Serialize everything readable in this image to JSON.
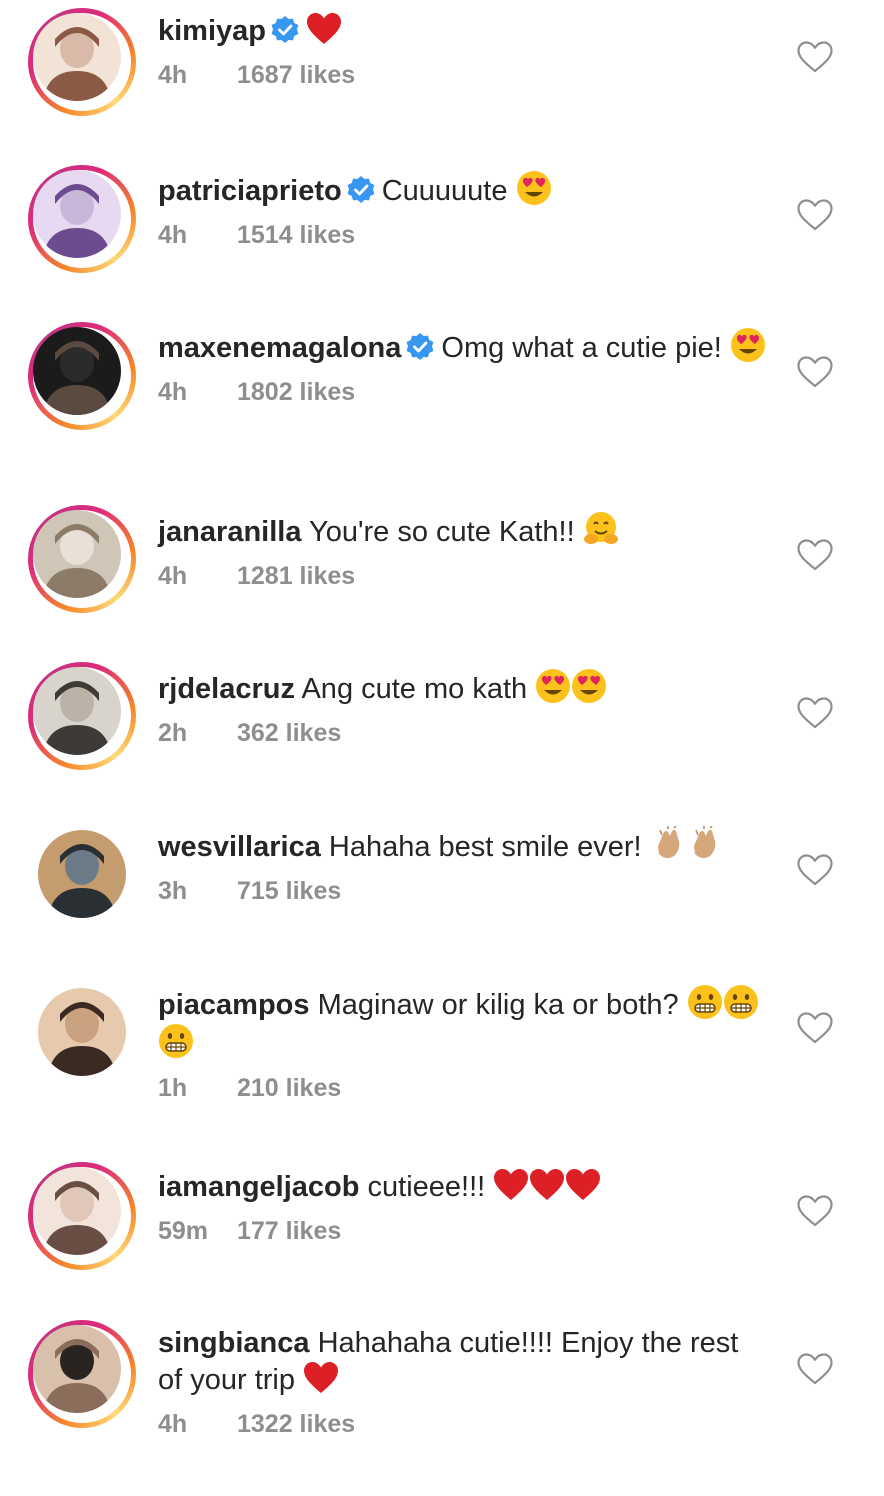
{
  "colors": {
    "text": "#262626",
    "meta": "#8e8e8e",
    "verified": "#3897f0",
    "heart": "#ed4956"
  },
  "icons": {
    "like": "heart-outline-icon",
    "verified": "verified-badge-icon",
    "avatar": "avatar-photo"
  },
  "comments": [
    {
      "username": "kimiyap",
      "verified": true,
      "text": "",
      "emojis_after": [
        "red-heart"
      ],
      "time": "4h",
      "likes": "1687 likes",
      "ring": true
    },
    {
      "username": "patriciaprieto",
      "verified": true,
      "text": "Cuuuuute",
      "emojis_after": [
        "heart-eyes"
      ],
      "time": "4h",
      "likes": "1514 likes",
      "ring": true
    },
    {
      "username": "maxenemagalona",
      "verified": true,
      "text": "Omg what a cutie pie!",
      "emojis_after": [
        "heart-eyes"
      ],
      "time": "4h",
      "likes": "1802 likes",
      "ring": true
    },
    {
      "username": "janaranilla",
      "verified": false,
      "text": "You're so cute Kath!!",
      "emojis_after": [
        "hugging"
      ],
      "time": "4h",
      "likes": "1281 likes",
      "ring": true
    },
    {
      "username": "rjdelacruz",
      "verified": false,
      "text": "Ang cute mo kath",
      "emojis_after": [
        "heart-eyes",
        "heart-eyes"
      ],
      "time": "2h",
      "likes": "362 likes",
      "ring": true
    },
    {
      "username": "wesvillarica",
      "verified": false,
      "text": "Hahaha best smile ever!",
      "emojis_after": [
        "clap",
        "clap"
      ],
      "time": "3h",
      "likes": "715 likes",
      "ring": false
    },
    {
      "username": "piacampos",
      "verified": false,
      "text": "Maginaw or kilig ka or both?",
      "emojis_after": [
        "grimace",
        "grimace",
        "grimace"
      ],
      "time": "1h",
      "likes": "210 likes",
      "ring": false
    },
    {
      "username": "iamangeljacob",
      "verified": false,
      "text": "cutieee!!!",
      "emojis_after": [
        "red-heart",
        "red-heart",
        "red-heart"
      ],
      "time": "59m",
      "likes": "177 likes",
      "ring": true
    },
    {
      "username": "singbianca",
      "verified": false,
      "text": "Hahahaha cutie!!!! Enjoy the rest of your trip",
      "emojis_after": [
        "red-heart"
      ],
      "time": "4h",
      "likes": "1322 likes",
      "ring": true
    }
  ]
}
